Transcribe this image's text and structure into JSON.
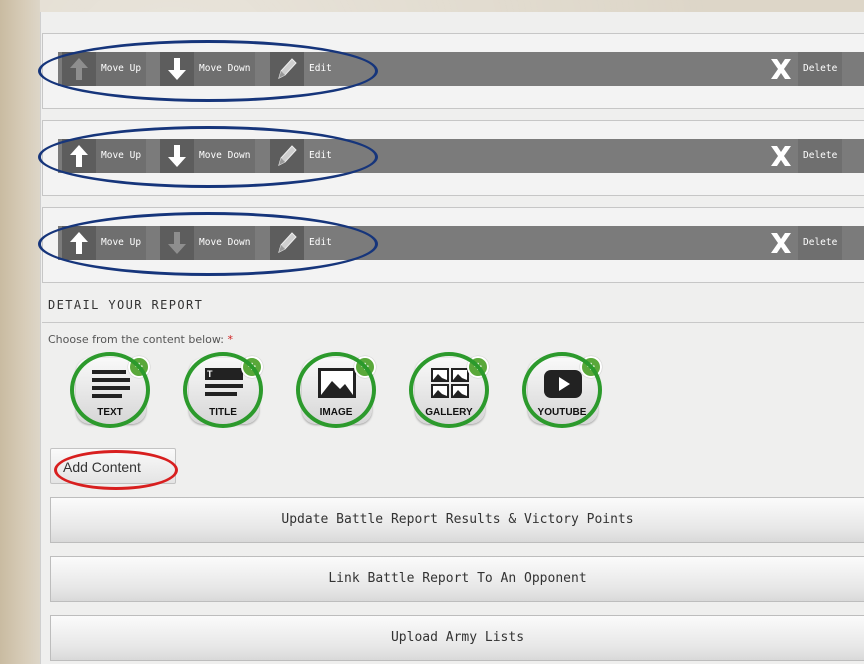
{
  "rows": [
    {
      "move_up": "Move Up",
      "move_down": "Move Down",
      "edit": "Edit",
      "delete": "Delete",
      "up_enabled": false,
      "down_enabled": true
    },
    {
      "move_up": "Move Up",
      "move_down": "Move Down",
      "edit": "Edit",
      "delete": "Delete",
      "up_enabled": true,
      "down_enabled": true
    },
    {
      "move_up": "Move Up",
      "move_down": "Move Down",
      "edit": "Edit",
      "delete": "Delete",
      "up_enabled": true,
      "down_enabled": false
    }
  ],
  "section": {
    "title": "DETAIL YOUR REPORT",
    "choose_label": "Choose from the content below:",
    "required_mark": "*"
  },
  "content_types": [
    {
      "label": "TEXT",
      "icon": "text-lines-icon"
    },
    {
      "label": "TITLE",
      "icon": "title-lines-icon"
    },
    {
      "label": "IMAGE",
      "icon": "image-icon"
    },
    {
      "label": "GALLERY",
      "icon": "gallery-icon"
    },
    {
      "label": "YOUTUBE",
      "icon": "youtube-play-icon"
    }
  ],
  "add_content_label": "Add Content",
  "actions": {
    "update_results": "Update Battle Report Results & Victory Points",
    "link_opponent": "Link Battle Report To An Opponent",
    "upload_lists": "Upload Army Lists"
  },
  "colors": {
    "annotation_blue": "#16357b",
    "annotation_green": "#2c9a2c",
    "annotation_red": "#d81f1f",
    "bar_gray": "#7b7b7b"
  }
}
